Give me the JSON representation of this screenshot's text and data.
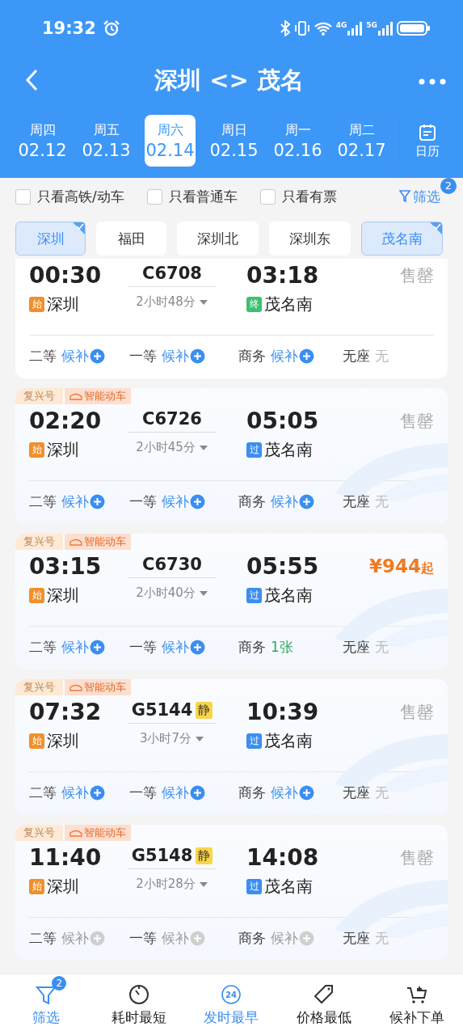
{
  "status_bar": {
    "time": "19:32",
    "networks": [
      "4G",
      "5G"
    ]
  },
  "header": {
    "title": "深圳 <> 茂名"
  },
  "dates": [
    {
      "weekday": "周四",
      "date": "02.12",
      "selected": false
    },
    {
      "weekday": "周五",
      "date": "02.13",
      "selected": false
    },
    {
      "weekday": "周六",
      "date": "02.14",
      "selected": true
    },
    {
      "weekday": "周日",
      "date": "02.15",
      "selected": false
    },
    {
      "weekday": "周一",
      "date": "02.16",
      "selected": false
    },
    {
      "weekday": "周二",
      "date": "02.17",
      "selected": false
    }
  ],
  "calendar_label": "日历",
  "filters": [
    {
      "label": "只看高铁/动车",
      "checked": false
    },
    {
      "label": "只看普通车",
      "checked": false
    },
    {
      "label": "只看有票",
      "checked": false
    }
  ],
  "filter_button": {
    "label": "筛选",
    "badge": "2"
  },
  "stations": [
    {
      "name": "深圳",
      "selected": true
    },
    {
      "name": "福田",
      "selected": false
    },
    {
      "name": "深圳北",
      "selected": false
    },
    {
      "name": "深圳东",
      "selected": false
    },
    {
      "name": "茂名南",
      "selected": true
    }
  ],
  "trains": [
    {
      "depart": "00:30",
      "train_no": "C6708",
      "duration": "2小时48分",
      "arrive": "03:18",
      "from_badge": "始",
      "from": "深圳",
      "to_badge": {
        "text": "终",
        "kind": "terminal"
      },
      "to": "茂名南",
      "status": "售罄",
      "seats": [
        {
          "class": "二等",
          "status": "候补",
          "kind": "waitlist",
          "disabled": false
        },
        {
          "class": "一等",
          "status": "候补",
          "kind": "waitlist",
          "disabled": false
        },
        {
          "class": "商务",
          "status": "候补",
          "kind": "waitlist",
          "disabled": false
        },
        {
          "class": "无座",
          "status": "无",
          "kind": "none",
          "disabled": true
        }
      ]
    },
    {
      "tags": [
        {
          "text": "复兴号",
          "kind": "plain"
        },
        {
          "text": "智能动车",
          "kind": "smart"
        }
      ],
      "depart": "02:20",
      "train_no": "C6726",
      "duration": "2小时45分",
      "arrive": "05:05",
      "from_badge": "始",
      "from": "深圳",
      "to_badge": {
        "text": "过",
        "kind": "pass"
      },
      "to": "茂名南",
      "status": "售罄",
      "seats": [
        {
          "class": "二等",
          "status": "候补",
          "kind": "waitlist",
          "disabled": false
        },
        {
          "class": "一等",
          "status": "候补",
          "kind": "waitlist",
          "disabled": false
        },
        {
          "class": "商务",
          "status": "候补",
          "kind": "waitlist",
          "disabled": false
        },
        {
          "class": "无座",
          "status": "无",
          "kind": "none",
          "disabled": true
        }
      ]
    },
    {
      "tags": [
        {
          "text": "复兴号",
          "kind": "plain"
        },
        {
          "text": "智能动车",
          "kind": "smart"
        }
      ],
      "depart": "03:15",
      "train_no": "C6730",
      "duration": "2小时40分",
      "arrive": "05:55",
      "from_badge": "始",
      "from": "深圳",
      "to_badge": {
        "text": "过",
        "kind": "pass"
      },
      "to": "茂名南",
      "price": "¥944",
      "price_suffix": "起",
      "seats": [
        {
          "class": "二等",
          "status": "候补",
          "kind": "waitlist",
          "disabled": false
        },
        {
          "class": "一等",
          "status": "候补",
          "kind": "waitlist",
          "disabled": false
        },
        {
          "class": "商务",
          "status": "1张",
          "kind": "available",
          "disabled": false
        },
        {
          "class": "无座",
          "status": "无",
          "kind": "none",
          "disabled": true
        }
      ]
    },
    {
      "tags": [
        {
          "text": "复兴号",
          "kind": "plain"
        },
        {
          "text": "智能动车",
          "kind": "smart"
        }
      ],
      "depart": "07:32",
      "train_no": "G5144",
      "quiet_badge": "静",
      "duration": "3小时7分",
      "arrive": "10:39",
      "from_badge": "始",
      "from": "深圳",
      "to_badge": {
        "text": "过",
        "kind": "pass"
      },
      "to": "茂名南",
      "status": "售罄",
      "seats": [
        {
          "class": "二等",
          "status": "候补",
          "kind": "waitlist",
          "disabled": false
        },
        {
          "class": "一等",
          "status": "候补",
          "kind": "waitlist",
          "disabled": false
        },
        {
          "class": "商务",
          "status": "候补",
          "kind": "waitlist",
          "disabled": false
        },
        {
          "class": "无座",
          "status": "无",
          "kind": "none",
          "disabled": true
        }
      ]
    },
    {
      "tags": [
        {
          "text": "复兴号",
          "kind": "plain"
        },
        {
          "text": "智能动车",
          "kind": "smart"
        }
      ],
      "depart": "11:40",
      "train_no": "G5148",
      "quiet_badge": "静",
      "duration": "2小时28分",
      "arrive": "14:08",
      "from_badge": "始",
      "from": "深圳",
      "to_badge": {
        "text": "过",
        "kind": "pass"
      },
      "to": "茂名南",
      "status": "售罄",
      "seats": [
        {
          "class": "二等",
          "status": "候补",
          "kind": "waitlist",
          "disabled": true
        },
        {
          "class": "一等",
          "status": "候补",
          "kind": "waitlist",
          "disabled": true
        },
        {
          "class": "商务",
          "status": "候补",
          "kind": "waitlist",
          "disabled": true
        },
        {
          "class": "无座",
          "status": "无",
          "kind": "none",
          "disabled": true
        }
      ]
    }
  ],
  "bottom_nav": [
    {
      "label": "筛选",
      "kind": "filter",
      "selected": true,
      "badge": "2"
    },
    {
      "label": "耗时最短",
      "kind": "timer",
      "selected": false
    },
    {
      "label": "发时最早",
      "kind": "day",
      "selected": true,
      "icon_text": "24"
    },
    {
      "label": "价格最低",
      "kind": "tag",
      "selected": false
    },
    {
      "label": "候补下单",
      "kind": "cart",
      "selected": false
    }
  ]
}
